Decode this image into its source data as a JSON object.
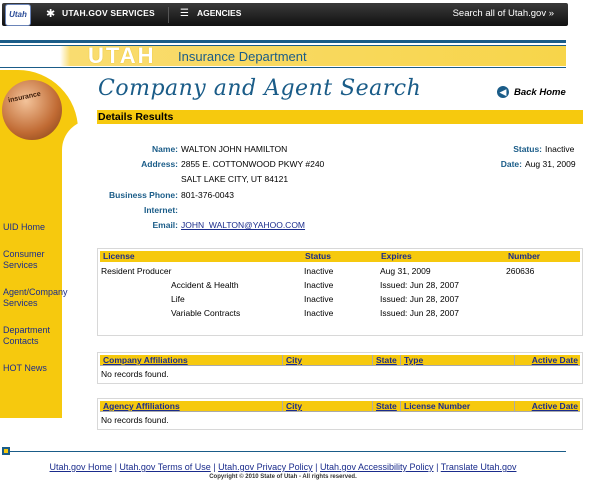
{
  "topbar": {
    "logo_text": "Utah",
    "services_label": "UTAH.GOV SERVICES",
    "agencies_label": "AGENCIES",
    "search_all_label": "Search all of Utah.gov »",
    "gear_icon": "gear-icon",
    "list_icon": "list-icon"
  },
  "header": {
    "brand": "UTAH",
    "dept": "Insurance Department"
  },
  "sidebar": {
    "orb_text": "insurance",
    "items": [
      "UID Home",
      "Consumer Services",
      "Agent/Company Services",
      "Department Contacts",
      "HOT News"
    ]
  },
  "page": {
    "title": "Company and Agent Search",
    "back_label": "Back Home",
    "details_label": "Details Results"
  },
  "agent": {
    "name_label": "Name:",
    "name": "WALTON JOHN HAMILTON",
    "address_label": "Address:",
    "address1": "2855 E. COTTONWOOD PKWY #240",
    "address2": "SALT LAKE CITY, UT 84121",
    "phone_label": "Business Phone:",
    "phone": "801-376-0043",
    "internet_label": "Internet:",
    "internet": "",
    "email_label": "Email:",
    "email": "JOHN_WALTON@YAHOO.COM",
    "status_label": "Status:",
    "status": "Inactive",
    "date_label": "Date:",
    "date": "Aug 31, 2009"
  },
  "license_table": {
    "headers": [
      "License",
      "Status",
      "Expires",
      "Number"
    ],
    "rows": [
      [
        "Resident Producer",
        "Inactive",
        "Aug 31, 2009",
        "260636"
      ],
      [
        "Accident & Health",
        "Inactive",
        "Issued: Jun 28, 2007",
        ""
      ],
      [
        "Life",
        "Inactive",
        "Issued: Jun 28, 2007",
        ""
      ],
      [
        "Variable Contracts",
        "Inactive",
        "Issued: Jun 28, 2007",
        ""
      ]
    ]
  },
  "company_table": {
    "headers": [
      "Company Affiliations",
      "City",
      "State",
      "Type",
      "Active Date"
    ],
    "empty": "No records found."
  },
  "agency_table": {
    "headers": [
      "Agency Affiliations",
      "City",
      "State",
      "License Number",
      "Active Date"
    ],
    "empty": "No records found."
  },
  "footer": {
    "links": [
      "Utah.gov Home",
      "Utah.gov Terms of Use",
      "Utah.gov Privacy Policy",
      "Utah.gov Accessibility Policy",
      "Translate Utah.gov"
    ],
    "copyright": "Copyright © 2010 State of Utah - All rights reserved."
  },
  "colors": {
    "accent": "#f6c90e",
    "brand_blue": "#1a5c88",
    "link": "#1a2c8c"
  }
}
